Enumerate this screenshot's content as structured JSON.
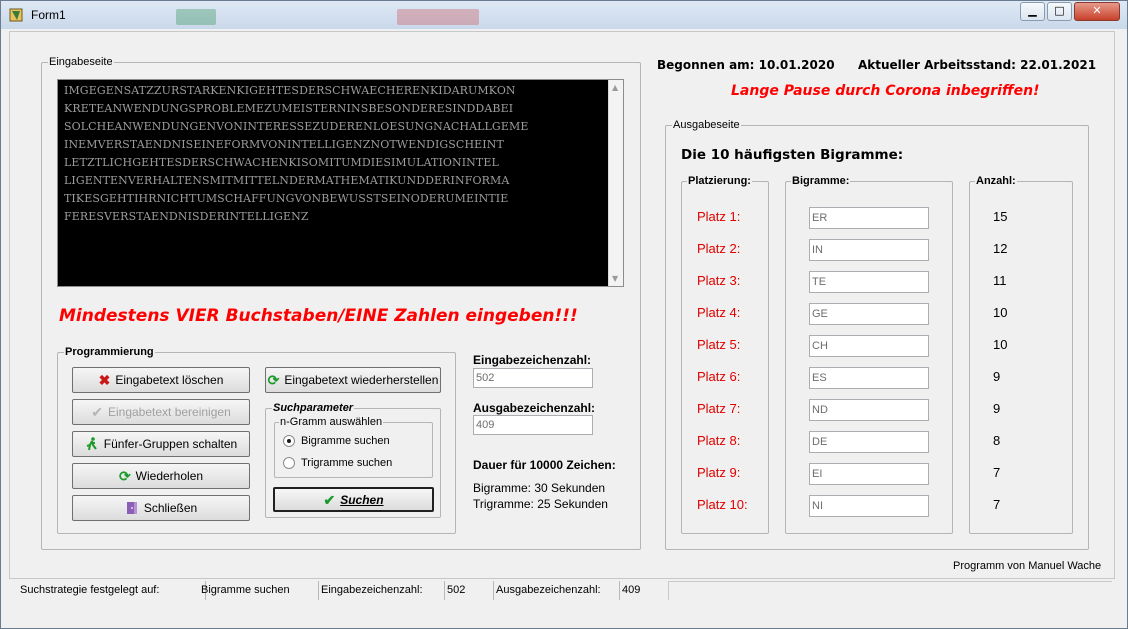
{
  "window": {
    "title": "Form1",
    "buttons": {
      "minimize": "▁",
      "maximize": "□",
      "close": "✕"
    }
  },
  "eingabe": {
    "legend": "Eingabeseite",
    "text": "IMGEGENSATZZURSTARKENKIGEHTESDERSCHWAECHERENKIDARUMKON\nKRETEANWENDUNGSPROBLEMEZUMEISTERNINSBESONDERESINDDABEI\nSOLCHEANWENDUNGENVONINTERESSEZUDERENLOESUNGNACHALLGEME\nINEMVERSTAENDNISEINEFORMVONINTELLIGENZNOTWENDIGSCHEINT\nLETZTLICHGEHTESDERSCHWACHENKISOMITUMDIESIMULATIONINTEL\nLIGENTENVERHALTENSMITMITTELNDERMATHEMATIKUNDDERINFORMA\nTIKESGEHTIHRNICHTUMSCHAFFUNGVONBEWUSSTSEINODERUMEINTIE\nFERESVERSTAENDNISDERINTELLIGENZ",
    "warning": "Mindestens VIER Buchstaben/EINE Zahlen eingeben!!!"
  },
  "programmierung": {
    "legend": "Programmierung",
    "buttons": {
      "loeschen": "Eingabetext löschen",
      "bereinigen": "Eingabetext bereinigen",
      "fuenfer": "Fünfer-Gruppen schalten",
      "wiederholen": "Wiederholen",
      "schliessen": "Schließen",
      "wiederherstellen": "Eingabetext wiederherstellen",
      "suchen": "Suchen"
    },
    "suchparameter": {
      "legend": "Suchparameter",
      "ngram_legend": "n-Gramm auswählen",
      "options": [
        "Bigramme suchen",
        "Trigramme suchen"
      ],
      "selected": "Bigramme suchen"
    }
  },
  "counts": {
    "eingabe_label": "Eingabezeichenzahl:",
    "eingabe_value": "502",
    "ausgabe_label": "Ausgabezeichenzahl:",
    "ausgabe_value": "409",
    "dauer_label": "Dauer für 10000 Zeichen:",
    "dauer_bigramme": "Bigramme: 30 Sekunden",
    "dauer_trigramme": "Trigramme: 25 Sekunden"
  },
  "header": {
    "begonnen": "Begonnen am: 10.01.2020",
    "stand": "Aktueller Arbeitsstand: 22.01.2021",
    "pause": "Lange Pause durch Corona inbegriffen!"
  },
  "ausgabe": {
    "legend": "Ausgabeseite",
    "title": "Die 10 häufigsten Bigramme:",
    "col_platz": "Platzierung:",
    "col_bigramme": "Bigramme:",
    "col_anzahl": "Anzahl:",
    "rows": [
      {
        "platz": "Platz 1:",
        "bigramm": "ER",
        "anzahl": "15"
      },
      {
        "platz": "Platz 2:",
        "bigramm": "IN",
        "anzahl": "12"
      },
      {
        "platz": "Platz 3:",
        "bigramm": "TE",
        "anzahl": "11"
      },
      {
        "platz": "Platz 4:",
        "bigramm": "GE",
        "anzahl": "10"
      },
      {
        "platz": "Platz 5:",
        "bigramm": "CH",
        "anzahl": "10"
      },
      {
        "platz": "Platz 6:",
        "bigramm": "ES",
        "anzahl": "9"
      },
      {
        "platz": "Platz 7:",
        "bigramm": "ND",
        "anzahl": "9"
      },
      {
        "platz": "Platz 8:",
        "bigramm": "DE",
        "anzahl": "8"
      },
      {
        "platz": "Platz 9:",
        "bigramm": "EI",
        "anzahl": "7"
      },
      {
        "platz": "Platz 10:",
        "bigramm": "NI",
        "anzahl": "7"
      }
    ]
  },
  "footer": {
    "author": "Programm von Manuel Wache"
  },
  "statusbar": {
    "strategie_label": "Suchstrategie festgelegt auf:",
    "strategie_value": "Bigramme suchen",
    "eingabe_label": "Eingabezeichenzahl:",
    "eingabe_value": "502",
    "ausgabe_label": "Ausgabezeichenzahl:",
    "ausgabe_value": "409"
  },
  "colors": {
    "accent_red": "#ff0000",
    "platz_red": "#e00000",
    "memo_bg": "#000000"
  }
}
